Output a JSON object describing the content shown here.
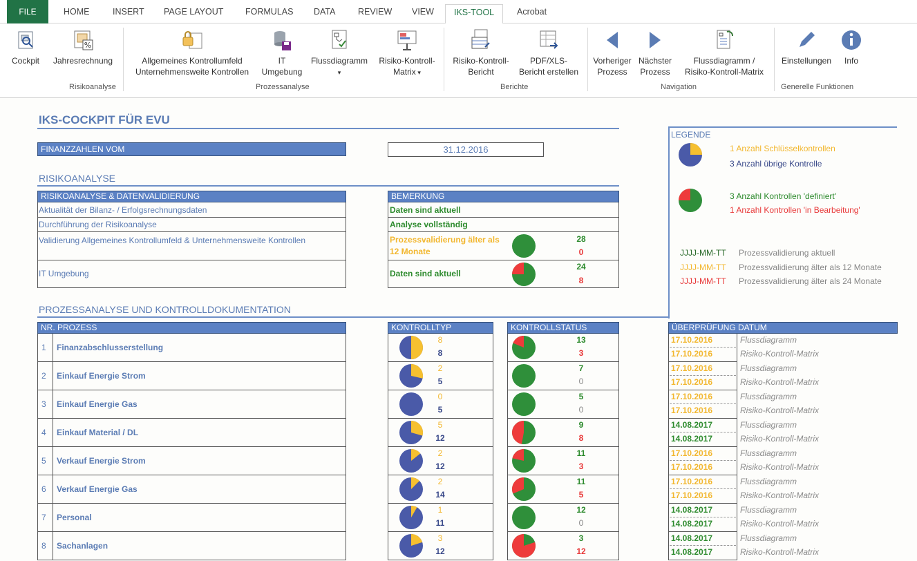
{
  "ribbon": {
    "tabs": [
      "FILE",
      "HOME",
      "INSERT",
      "PAGE LAYOUT",
      "FORMULAS",
      "DATA",
      "REVIEW",
      "VIEW",
      "IKS-TOOL",
      "Acrobat"
    ],
    "buttons": {
      "cockpit": "Cockpit",
      "jahresrechnung": "Jahresrechnung",
      "kontrollumfeld_1": "Allgemeines Kontrollumfeld",
      "kontrollumfeld_2": "Unternehmensweite Kontrollen",
      "it_1": "IT",
      "it_2": "Umgebung",
      "fluss": "Flussdiagramm",
      "rkm_1": "Risiko-Kontroll-",
      "rkm_2": "Matrix",
      "rkb_1": "Risiko-Kontroll-",
      "rkb_2": "Bericht",
      "pdf_1": "PDF/XLS-",
      "pdf_2": "Bericht erstellen",
      "prev_1": "Vorheriger",
      "prev_2": "Prozess",
      "next_1": "Nächster",
      "next_2": "Prozess",
      "fr_1": "Flussdiagramm /",
      "fr_2": "Risiko-Kontroll-Matrix",
      "einstellungen": "Einstellungen",
      "info": "Info"
    },
    "groups": {
      "risikoanalyse": "Risikoanalyse",
      "prozessanalyse": "Prozessanalyse",
      "berichte": "Berichte",
      "navigation": "Navigation",
      "generelle": "Generelle Funktionen"
    }
  },
  "sheet": {
    "title": "IKS-COCKPIT FÜR EVU",
    "finanzzahlen_label": "FINANZZAHLEN VOM",
    "finanzzahlen_date": "31.12.2016",
    "risikoanalyse_heading": "RISIKOANALYSE",
    "ra_header": "RISIKOANALYSE & DATENVALIDIERUNG",
    "bemerkung_header": "BEMERKUNG",
    "ra_rows": [
      {
        "label": "Aktualität der Bilanz- / Erfolgsrechnungsdaten",
        "remark": "Daten sind aktuell"
      },
      {
        "label": "Durchführung der Risikoanalyse",
        "remark": "Analyse vollständig"
      },
      {
        "label": "Validierung Allgemeines Kontrollumfeld & Unternehmensweite Kontrollen",
        "remark": "Prozessvalidierung älter als 12 Monate",
        "defined": "28",
        "in_progress": "0"
      },
      {
        "label": "IT Umgebung",
        "remark": "Daten sind aktuell",
        "defined": "24",
        "in_progress": "8"
      }
    ],
    "legend": {
      "title": "LEGENDE",
      "key_controls": "1 Anzahl Schlüsselkontrollen",
      "other_controls": "3 Anzahl übrige Kontrolle",
      "defined": "3 Anzahl Kontrollen 'definiert'",
      "in_progress": "1 Anzahl Kontrollen 'in Bearbeitung'",
      "date_format": "JJJJ-MM-TT",
      "current": "Prozessvalidierung aktuell",
      "older_12": "Prozessvalidierung älter als 12 Monate",
      "older_24": "Prozessvalidierung älter als 24 Monate"
    },
    "pa_heading": "PROZESSANALYSE UND KONTROLLDOKUMENTATION",
    "col_headers": {
      "process": "NR. PROZESS",
      "kontrolltyp": "KONTROLLTYP",
      "kontrollstatus": "KONTROLLSTATUS",
      "review": "ÜBERPRÜFUNG DATUM"
    },
    "flussdiagramm": "Flussdiagramm",
    "rkm": "Risiko-Kontroll-Matrix",
    "processes": [
      {
        "nr": "1",
        "name": "Finanzabschlusserstellung",
        "key": "8",
        "other": "8",
        "defined": "13",
        "inprog": "3",
        "d1": "17.10.2016",
        "d1c": "yel",
        "d2": "17.10.2016",
        "d2c": "yel"
      },
      {
        "nr": "2",
        "name": "Einkauf Energie Strom",
        "key": "2",
        "other": "5",
        "defined": "7",
        "inprog": "0",
        "d1": "17.10.2016",
        "d1c": "yel",
        "d2": "17.10.2016",
        "d2c": "yel"
      },
      {
        "nr": "3",
        "name": "Einkauf Energie Gas",
        "key": "0",
        "other": "5",
        "defined": "5",
        "inprog": "0",
        "d1": "17.10.2016",
        "d1c": "yel",
        "d2": "17.10.2016",
        "d2c": "yel"
      },
      {
        "nr": "4",
        "name": "Einkauf Material / DL",
        "key": "5",
        "other": "12",
        "defined": "9",
        "inprog": "8",
        "d1": "14.08.2017",
        "d1c": "grn",
        "d2": "14.08.2017",
        "d2c": "grn"
      },
      {
        "nr": "5",
        "name": "Verkauf Energie Strom",
        "key": "2",
        "other": "12",
        "defined": "11",
        "inprog": "3",
        "d1": "17.10.2016",
        "d1c": "yel",
        "d2": "17.10.2016",
        "d2c": "yel"
      },
      {
        "nr": "6",
        "name": "Verkauf Energie Gas",
        "key": "2",
        "other": "14",
        "defined": "11",
        "inprog": "5",
        "d1": "17.10.2016",
        "d1c": "yel",
        "d2": "17.10.2016",
        "d2c": "yel"
      },
      {
        "nr": "7",
        "name": "Personal",
        "key": "1",
        "other": "11",
        "defined": "12",
        "inprog": "0",
        "d1": "14.08.2017",
        "d1c": "grn",
        "d2": "14.08.2017",
        "d2c": "grn"
      },
      {
        "nr": "8",
        "name": "Sachanlagen",
        "key": "3",
        "other": "12",
        "defined": "3",
        "inprog": "12",
        "d1": "14.08.2017",
        "d1c": "grn",
        "d2": "14.08.2017",
        "d2c": "grn"
      }
    ]
  },
  "colors": {
    "blue_header": "#5b81c4",
    "pie_blue": "#4a5aa8",
    "pie_yellow": "#f6c030",
    "pie_green": "#2f8f3a",
    "pie_red": "#ee3b3b",
    "excel_green": "#217346"
  }
}
